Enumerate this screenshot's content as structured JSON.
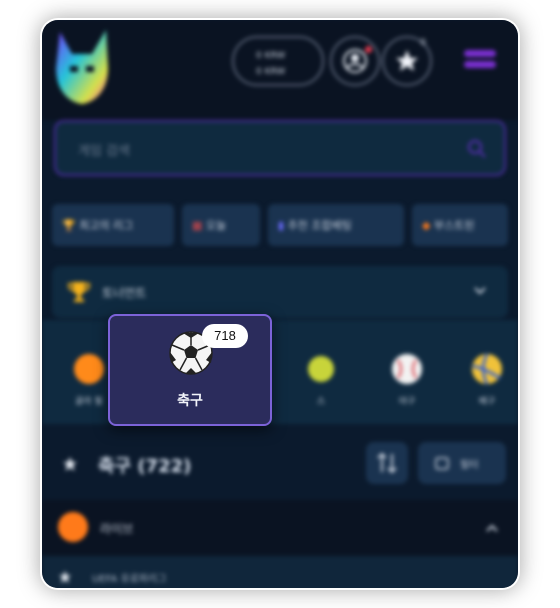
{
  "header": {
    "wallet_line1": "0 KRW",
    "wallet_line2": "0 KRW",
    "favorites_count": "0"
  },
  "search": {
    "placeholder": "게임 검색"
  },
  "quick_chips": [
    {
      "label": "최고의 리그",
      "icon": "trophy-icon"
    },
    {
      "label": "오늘",
      "icon": "calendar-icon"
    },
    {
      "label": "추천 조합베팅",
      "icon": "ticket-icon"
    },
    {
      "label": "부스트된",
      "icon": "fire-icon"
    }
  ],
  "tournament": {
    "label": "토너먼트"
  },
  "sports_strip": [
    {
      "label": "골라 필",
      "icon": "ball-icon"
    },
    {
      "label": "스",
      "icon": "tennis-icon"
    },
    {
      "label": "야구",
      "icon": "baseball-icon"
    },
    {
      "label": "배구",
      "icon": "volleyball-icon"
    }
  ],
  "focused_sport": {
    "label": "축구",
    "count": "718",
    "icon": "soccer-ball-icon"
  },
  "section": {
    "title": "축구 (722)",
    "filter_label": "필터"
  },
  "league": {
    "name": "라이브"
  },
  "match_row": {
    "text": "UEFA 유로파리그"
  },
  "colors": {
    "background": "#0b1a2d",
    "header": "#0a1322",
    "accent": "#7b2fd1",
    "card": "#2b2c5c",
    "card_border": "#7c63d8"
  }
}
